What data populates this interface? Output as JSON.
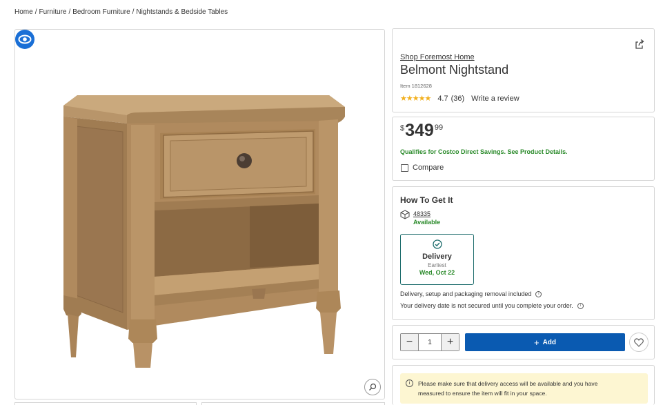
{
  "breadcrumb": [
    "Home",
    "Furniture",
    "Bedroom Furniture",
    "Nightstands & Bedside Tables"
  ],
  "product": {
    "brand": "Shop Foremost Home",
    "name": "Belmont Nightstand",
    "item_number": "Item 1812628",
    "rating": "4.7",
    "review_count": "(36)",
    "write_review": "Write a review",
    "stars_display": "★★★★★",
    "rating_value_numeric": 4.7,
    "image_icon": "nightstand-photo"
  },
  "price": {
    "currency": "$",
    "whole": "349",
    "cents": "99",
    "qualifies": "Qualifies for Costco Direct Savings. See Product Details.",
    "compare_label": "Compare",
    "compare_checked": false
  },
  "how_to_get": {
    "title": "How To Get It",
    "zip": "48335",
    "availability": "Available",
    "delivery_option": {
      "label": "Delivery",
      "earliest_label": "Earliest",
      "date": "Wed, Oct 22"
    },
    "note_1": "Delivery, setup and packaging removal included",
    "note_2": "Your delivery date is not secured until you complete your order."
  },
  "purchase": {
    "quantity": "1",
    "minus": "−",
    "plus": "+",
    "add_label": "Add",
    "add_plus": "+"
  },
  "notice": {
    "text_line1": "Please make sure that delivery access will be available and you have",
    "text_line2": "measured to ensure the item will fit in your space."
  },
  "colors": {
    "accent_blue": "#0a5ab1",
    "available_green": "#2a8a2a",
    "notice_bg": "#fdf6d2",
    "star_gold": "#f2b01e"
  },
  "icons": {
    "view": "eye-icon",
    "zoom": "magnifier-icon",
    "share": "share-icon",
    "box": "package-icon",
    "check": "check-circle-icon",
    "info": "info-icon",
    "heart": "heart-icon"
  }
}
